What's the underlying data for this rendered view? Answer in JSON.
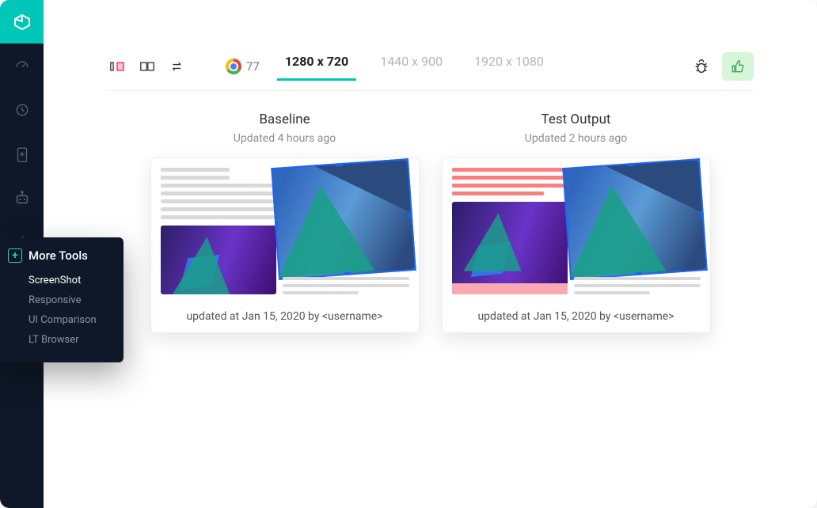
{
  "sidebar": {
    "icons": [
      "dashboard",
      "history",
      "battery",
      "robot",
      "flash"
    ]
  },
  "toolbar": {
    "chrome_version": "77",
    "resolutions": [
      "1280 x 720",
      "1440 x 900",
      "1920 x 1080"
    ],
    "active_resolution_index": 0
  },
  "tooltip": {
    "title": "More Tools",
    "items": [
      "ScreenShot",
      "Responsive",
      "UI Comparison",
      "LT Browser"
    ],
    "highlight_index": 0
  },
  "baseline": {
    "title": "Baseline",
    "subtitle": "Updated 4 hours ago",
    "footer": "updated at Jan 15, 2020 by <username>"
  },
  "test": {
    "title": "Test Output",
    "subtitle": "Updated 2 hours ago",
    "footer": "updated at Jan 15, 2020 by <username>"
  }
}
